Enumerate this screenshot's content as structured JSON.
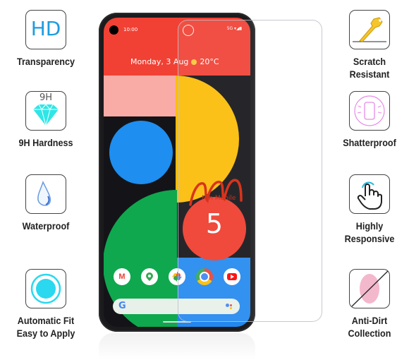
{
  "features_left": [
    {
      "label": "Transparency",
      "icon": "hd-icon",
      "icon_text": "HD"
    },
    {
      "label": "9H Hardness",
      "icon": "diamond-icon",
      "icon_text": "9H"
    },
    {
      "label": "Waterproof",
      "icon": "water-drop-icon"
    },
    {
      "label_line1": "Automatic Fit",
      "label_line2": "Easy to Apply",
      "icon": "target-circle-icon"
    }
  ],
  "features_right": [
    {
      "label_line1": "Scratch",
      "label_line2": "Resistant",
      "icon": "key-icon"
    },
    {
      "label": "Shatterproof",
      "icon": "shaking-phone-icon"
    },
    {
      "label_line1": "Highly",
      "label_line2": "Responsive",
      "icon": "touch-hand-icon"
    },
    {
      "label_line1": "Anti-Dirt",
      "label_line2": "Collection",
      "icon": "fingerprint-crossed-icon"
    }
  ],
  "phone": {
    "time": "10:00",
    "status": "5G ▾◢▮",
    "date": "Monday, 3 Aug",
    "temperature": "20°C",
    "model_number": "5",
    "dock_apps": [
      "Gmail",
      "Maps",
      "Photos",
      "Chrome",
      "YouTube"
    ],
    "search_logo": "G"
  },
  "watermark": "Min Mobile",
  "colors": {
    "accent_blue": "#1e9ce0",
    "diamond": "#2ee6e6",
    "red": "#f04134",
    "yellow": "#fbbc05",
    "green": "#0fa84e",
    "blue": "#1e8ef0"
  }
}
